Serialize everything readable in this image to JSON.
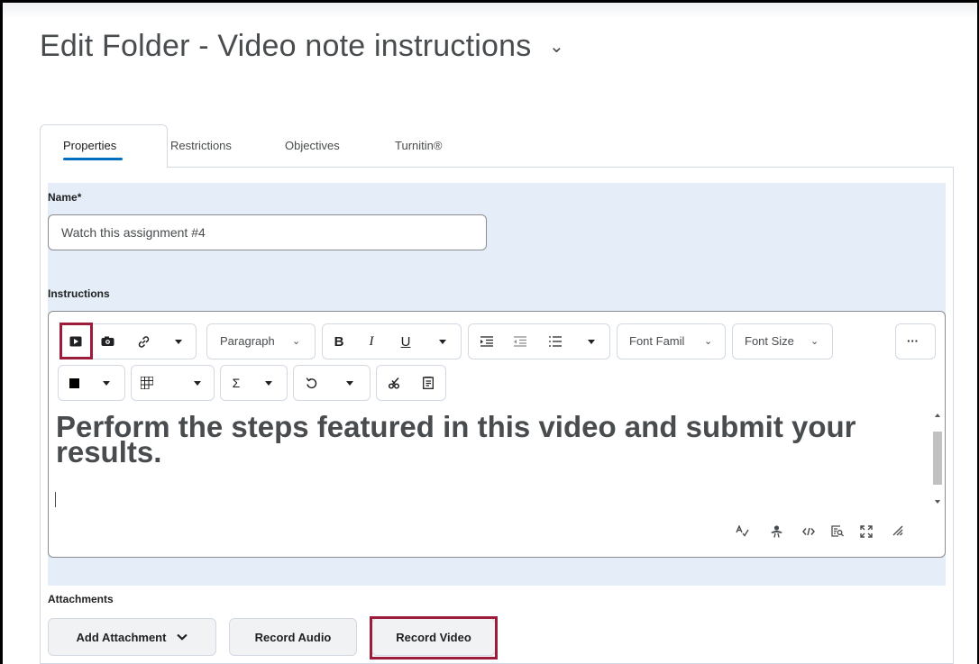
{
  "page": {
    "title": "Edit Folder - Video note instructions",
    "title_menu_icon": "chevron-down-icon"
  },
  "tabs": [
    {
      "label": "Properties",
      "active": true
    },
    {
      "label": "Restrictions",
      "active": false
    },
    {
      "label": "Objectives",
      "active": false
    },
    {
      "label": "Turnitin®",
      "active": false
    }
  ],
  "form": {
    "name_label": "Name",
    "required_marker": "*",
    "name_value": "Watch this assignment #4",
    "instructions_label": "Instructions",
    "attachments_label": "Attachments"
  },
  "editor": {
    "toolbar": {
      "paragraph_label": "Paragraph",
      "font_family_label": "Font Famil",
      "font_size_label": "Font Size",
      "more_label": "···"
    },
    "content": "Perform the steps featured in this video and submit your results.",
    "icons": {
      "insert_video": "play-icon",
      "insert_image": "camera-icon",
      "insert_link": "link-icon",
      "bold": "B",
      "italic": "I",
      "underline": "U",
      "indent": "indent-icon",
      "outdent": "outdent-icon",
      "list": "list-icon",
      "color": "color-square-icon",
      "table": "table-icon",
      "equation": "Σ",
      "undo": "undo-icon",
      "cut": "scissors-icon",
      "paste": "clipboard-icon",
      "spellcheck": "spellcheck-icon",
      "accessibility": "accessibility-icon",
      "source": "code-icon",
      "preview": "preview-icon",
      "fullscreen": "fullscreen-icon",
      "resize": "resize-handle-icon"
    }
  },
  "attachments": {
    "add_attachment_label": "Add Attachment",
    "record_audio_label": "Record Audio",
    "record_video_label": "Record Video"
  },
  "colors": {
    "accent": "#006fbf",
    "highlight": "#9d1b3b",
    "panel_background": "#e5eef8"
  }
}
